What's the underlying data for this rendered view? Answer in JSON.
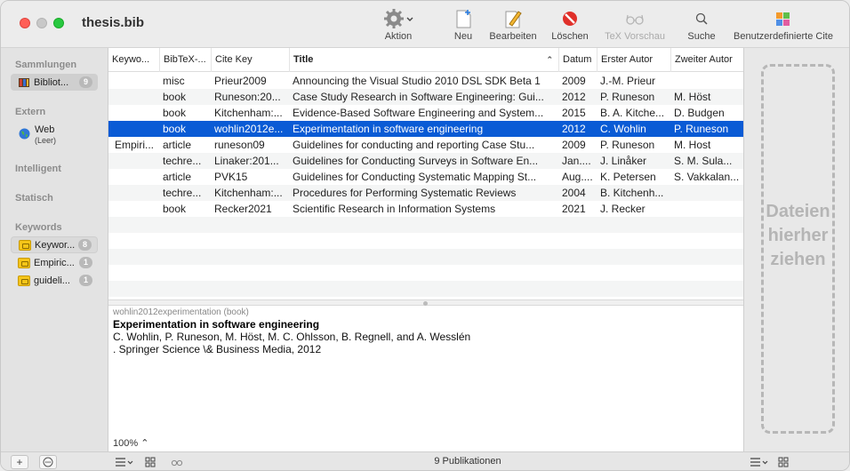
{
  "window": {
    "title": "thesis.bib"
  },
  "toolbar": {
    "action": "Aktion",
    "new": "Neu",
    "edit": "Bearbeiten",
    "delete": "Löschen",
    "tex_preview": "TeX Vorschau",
    "search": "Suche",
    "custom": "Benutzerdefinierte Cite"
  },
  "sidebar": {
    "sammlungen": "Sammlungen",
    "library": {
      "label": "Bibliot...",
      "count": "9"
    },
    "extern": "Extern",
    "web": {
      "label": "Web",
      "sub": "(Leer)"
    },
    "intelligent": "Intelligent",
    "statisch": "Statisch",
    "keywords_head": "Keywords",
    "keywords": [
      {
        "label": "Keywor...",
        "count": "8"
      },
      {
        "label": "Empiric...",
        "count": "1"
      },
      {
        "label": "guideli...",
        "count": "1"
      }
    ]
  },
  "table": {
    "headers": [
      "Keywo...",
      "BibTeX-...",
      "Cite Key",
      "Title",
      "Datum",
      "Erster Autor",
      "Zweiter Autor"
    ],
    "rows": [
      [
        "",
        "misc",
        "Prieur2009",
        "Announcing the Visual Studio 2010 DSL SDK Beta 1",
        "2009",
        "J.-M. Prieur",
        ""
      ],
      [
        "",
        "book",
        "Runeson:20...",
        "Case Study Research in Software Engineering: Gui...",
        "2012",
        "P. Runeson",
        "M. Höst"
      ],
      [
        "",
        "book",
        "Kitchenham:...",
        "Evidence-Based Software Engineering and System...",
        "2015",
        "B. A. Kitche...",
        "D. Budgen"
      ],
      [
        "",
        "book",
        "wohlin2012e...",
        "Experimentation in software engineering",
        "2012",
        "C. Wohlin",
        "P. Runeson"
      ],
      [
        "Empiri...",
        "article",
        "runeson09",
        "Guidelines for conducting and reporting Case Stu...",
        "2009",
        "P. Runeson",
        "M. Host"
      ],
      [
        "",
        "techre...",
        "Linaker:201...",
        "Guidelines for Conducting Surveys in Software En...",
        "Jan....",
        "J. Linåker",
        "S. M. Sula..."
      ],
      [
        "",
        "article",
        "PVK15",
        "Guidelines for Conducting Systematic Mapping St...",
        "Aug....",
        "K. Petersen",
        "S. Vakkalan..."
      ],
      [
        "",
        "techre...",
        "Kitchenham:...",
        "Procedures for Performing Systematic Reviews",
        "2004",
        "B. Kitchenh...",
        ""
      ],
      [
        "",
        "book",
        "Recker2021",
        "Scientific Research in Information Systems",
        "2021",
        "J. Recker",
        ""
      ]
    ]
  },
  "preview": {
    "key": "wohlin2012experimentation (book)",
    "title": "Experimentation in software engineering",
    "authors": "C. Wohlin, P. Runeson, M. Höst, M. C. Ohlsson, B. Regnell, and A. Wesslén",
    "publisher": ". Springer Science \\& Business Media, 2012",
    "zoom": "100% ⌃"
  },
  "droppane": {
    "line1": "Dateien",
    "line2": "hierher",
    "line3": "ziehen"
  },
  "status": {
    "count": "9 Publikationen"
  }
}
